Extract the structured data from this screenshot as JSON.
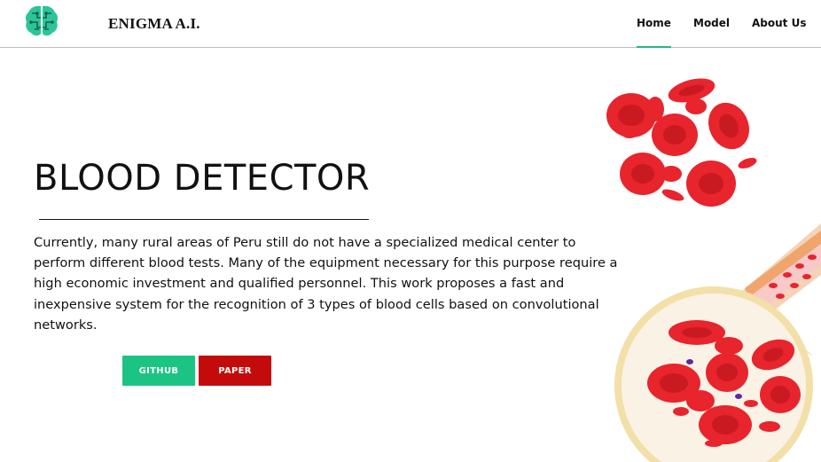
{
  "header": {
    "brand": "ENIGMA A.I.",
    "logo_icon": "brain-icon",
    "nav": [
      {
        "label": "Home",
        "active": true
      },
      {
        "label": "Model",
        "active": false
      },
      {
        "label": "About Us",
        "active": false
      }
    ]
  },
  "hero": {
    "title": "BLOOD DETECTOR",
    "description": "Currently, many rural areas of Peru still do not have a specialized medical center to perform different blood tests. Many of the equipment necessary for this purpose require a high economic investment and qualified personnel. This work proposes a fast and inexpensive system for the recognition of 3 types of blood cells based on convolutional networks.",
    "buttons": {
      "github": "GITHUB",
      "paper": "PAPER"
    },
    "illustration": "red-blood-cells-illustration"
  },
  "colors": {
    "accent": "#1fb98a",
    "github_button": "#1cc483",
    "paper_button": "#c40b0b",
    "cell_red": "#e8242d"
  }
}
